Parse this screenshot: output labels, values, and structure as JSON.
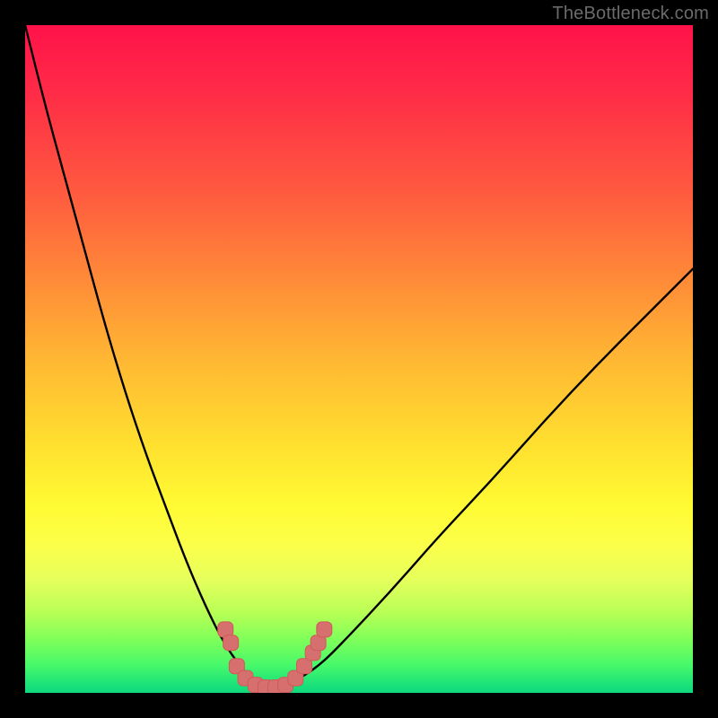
{
  "watermark": "TheBottleneck.com",
  "colors": {
    "frame": "#000000",
    "watermark_text": "#6b6b6b",
    "curve_stroke": "#000000",
    "marker_fill": "#d6706f",
    "marker_stroke": "#cf5a58"
  },
  "chart_data": {
    "type": "line",
    "title": "",
    "xlabel": "",
    "ylabel": "",
    "xlim": [
      0,
      100
    ],
    "ylim": [
      0,
      100
    ],
    "grid": false,
    "note": "Curve is an asymmetric V representing bottleneck deviation; y is the vertical extent in percent of plot height.",
    "series": [
      {
        "name": "bottleneck-curve",
        "x": [
          0,
          3,
          6,
          9,
          12,
          15,
          18,
          21,
          24,
          27,
          30,
          33,
          34.8,
          37,
          40,
          44,
          48,
          55,
          62,
          70,
          78,
          86,
          94,
          100
        ],
        "y": [
          100,
          88,
          77,
          66,
          55,
          45,
          36,
          28,
          20,
          13,
          7,
          3,
          1,
          0.5,
          1.5,
          4,
          8,
          15.5,
          23.5,
          32,
          41,
          49.5,
          57.5,
          63.5
        ]
      }
    ],
    "markers": [
      {
        "x": 30.0,
        "y": 9.5
      },
      {
        "x": 30.8,
        "y": 7.5
      },
      {
        "x": 31.7,
        "y": 4.0
      },
      {
        "x": 33.0,
        "y": 2.2
      },
      {
        "x": 34.5,
        "y": 1.2
      },
      {
        "x": 36.0,
        "y": 0.8
      },
      {
        "x": 37.5,
        "y": 0.8
      },
      {
        "x": 39.0,
        "y": 1.2
      },
      {
        "x": 40.5,
        "y": 2.2
      },
      {
        "x": 41.8,
        "y": 4.0
      },
      {
        "x": 43.1,
        "y": 6.0
      },
      {
        "x": 43.9,
        "y": 7.5
      },
      {
        "x": 44.8,
        "y": 9.5
      }
    ]
  }
}
